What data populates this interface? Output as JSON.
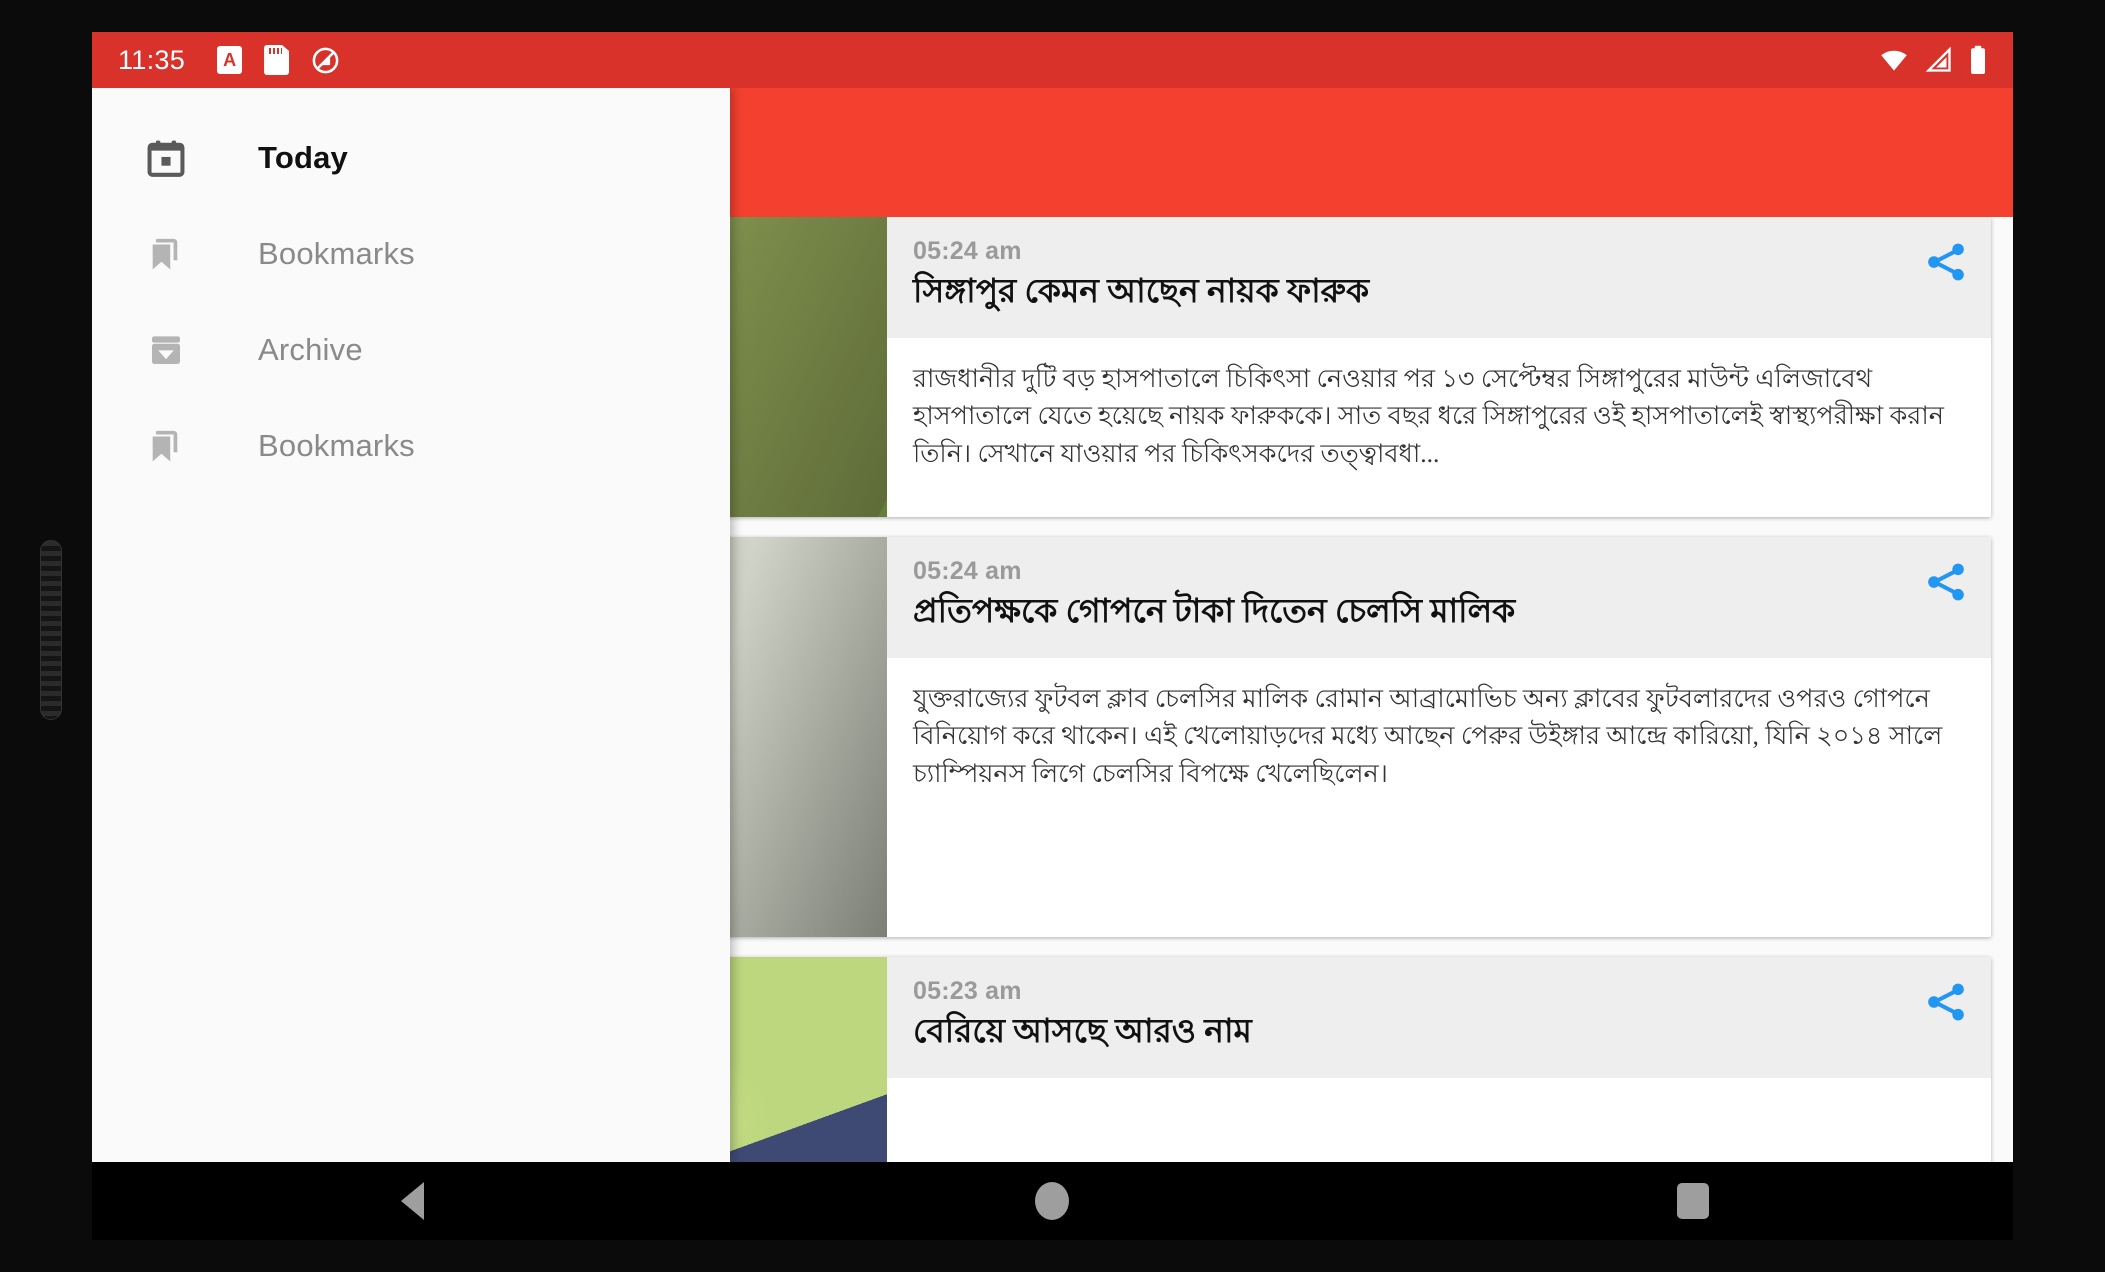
{
  "statusbar": {
    "clock": "11:35",
    "left_icons": [
      "app-notification-icon",
      "sd-card-icon",
      "do-not-disturb-icon"
    ],
    "right_icons": [
      "wifi-icon",
      "cell-signal-icon",
      "battery-icon"
    ],
    "background": "#D8322B"
  },
  "appbar": {
    "background": "#F4402F"
  },
  "drawer": {
    "items": [
      {
        "label": "Today",
        "icon": "calendar-today-icon",
        "active": true
      },
      {
        "label": "Bookmarks",
        "icon": "bookmarks-icon",
        "active": false
      },
      {
        "label": "Archive",
        "icon": "archive-icon",
        "active": false
      },
      {
        "label": "Bookmarks",
        "icon": "bookmarks-icon",
        "active": false
      }
    ]
  },
  "feed": {
    "accent_bookmark": "#1E88E5",
    "accent_share": "#2196F3",
    "cards": [
      {
        "time": "05:24 am",
        "headline": "সিঙ্গাপুর কেমন আছেন নায়ক ফারুক",
        "body": "রাজধানীর দুটি বড় হাসপাতালে চিকিৎসা নেওয়ার পর ১৩ সেপ্টেম্বর সিঙ্গাপুরের মাউন্ট এলিজাবেথ হাসপাতালে যেতে হয়েছে নায়ক ফারুককে। সাত বছর ধরে সিঙ্গাপুরের ওই হাসপাতালেই স্বাস্থ্যপরীক্ষা করান তিনি। সেখানে যাওয়ার পর চিকিৎসকদের তত্ত্বাবধা...",
        "image": "portrait-of-actor-farooq",
        "bookmark_icon": "bookmark-icon",
        "share_icon": "share-icon"
      },
      {
        "time": "05:24 am",
        "headline": "প্রতিপক্ষকে গোপনে টাকা দিতেন চেলসি মালিক",
        "body": "যুক্তরাজ্যের ফুটবল ক্লাব চেলসির মালিক রোমান আব্রামোভিচ অন্য ক্লাবের ফুটবলারদের ওপরও গোপনে বিনিয়োগ করে থাকেন। এই খেলোয়াড়দের মধ্যে আছেন পেরুর উইঙ্গার আন্দ্রে কারিয়ো, যিনি ২০১৪ সালে চ্যাম্পিয়নস লিগে চেলসির বিপক্ষে খেলেছিলেন।",
        "image": "portrait-of-roman-abramovich",
        "bookmark_icon": "bookmark-icon",
        "share_icon": "share-icon"
      },
      {
        "time": "05:23 am",
        "headline": "বেরিয়ে আসছে আরও নাম",
        "body": "",
        "image": "cartoon-illustration-green",
        "bookmark_icon": "bookmark-icon",
        "share_icon": "share-icon"
      }
    ]
  },
  "navbar": {
    "buttons": [
      {
        "name": "back-button",
        "icon": "back-triangle-icon"
      },
      {
        "name": "home-button",
        "icon": "home-circle-icon"
      },
      {
        "name": "recents-button",
        "icon": "recents-square-icon"
      }
    ]
  }
}
